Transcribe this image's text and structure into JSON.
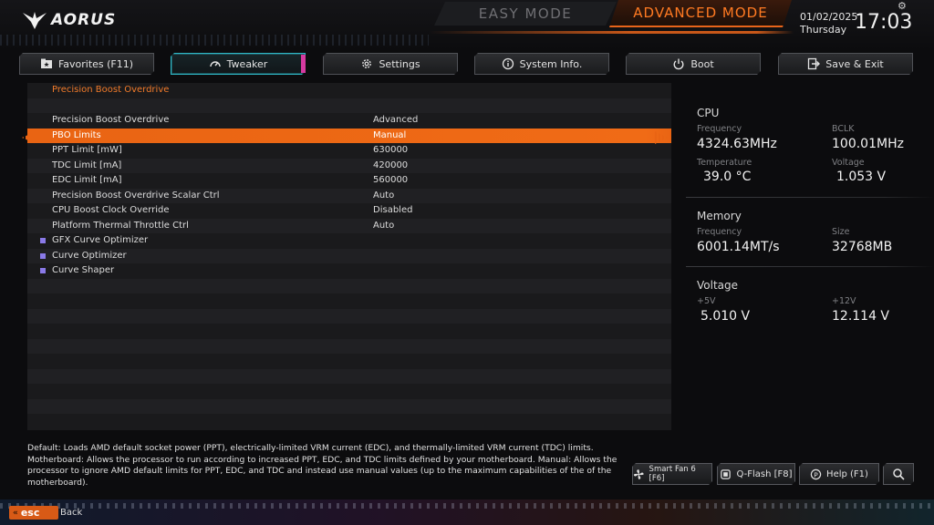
{
  "header": {
    "brand": "AORUS",
    "modes": {
      "easy": "EASY MODE",
      "advanced": "ADVANCED MODE",
      "active": "advanced"
    },
    "date": "01/02/2025",
    "day": "Thursday",
    "time": "17:03",
    "settings_glyph": "⚙"
  },
  "tabs": [
    {
      "label": "Favorites (F11)",
      "icon": "star-folder-icon"
    },
    {
      "label": "Tweaker",
      "icon": "speedometer-icon",
      "active": true
    },
    {
      "label": "Settings",
      "icon": "gear-icon"
    },
    {
      "label": "System Info.",
      "icon": "info-icon"
    },
    {
      "label": "Boot",
      "icon": "power-icon"
    },
    {
      "label": "Save & Exit",
      "icon": "exit-icon"
    }
  ],
  "list": {
    "section": "Precision Boost Overdrive",
    "rows": [
      {
        "label": "Precision Boost Overdrive",
        "value": "Advanced"
      },
      {
        "label": "PBO Limits",
        "value": "Manual",
        "selected": true
      },
      {
        "label": "PPT Limit [mW]",
        "value": "630000"
      },
      {
        "label": "TDC Limit [mA]",
        "value": "420000"
      },
      {
        "label": "EDC Limit [mA]",
        "value": "560000"
      },
      {
        "label": "Precision Boost Overdrive Scalar Ctrl",
        "value": "Auto"
      },
      {
        "label": "CPU Boost Clock Override",
        "value": "Disabled"
      },
      {
        "label": "Platform Thermal Throttle Ctrl",
        "value": "Auto"
      },
      {
        "label": "GFX Curve Optimizer",
        "value": "",
        "submenu": true
      },
      {
        "label": "Curve Optimizer",
        "value": "",
        "submenu": true
      },
      {
        "label": "Curve Shaper",
        "value": "",
        "submenu": true
      }
    ]
  },
  "info": {
    "cpu": {
      "title": "CPU",
      "frequency_label": "Frequency",
      "frequency": "4324.63MHz",
      "bclk_label": "BCLK",
      "bclk": "100.01MHz",
      "temperature_label": "Temperature",
      "temperature": "39.0 °C",
      "voltage_label": "Voltage",
      "voltage": "1.053 V"
    },
    "memory": {
      "title": "Memory",
      "frequency_label": "Frequency",
      "frequency": "6001.14MT/s",
      "size_label": "Size",
      "size": "32768MB"
    },
    "voltage": {
      "title": "Voltage",
      "v5_label": "+5V",
      "v5": "5.010 V",
      "v12_label": "+12V",
      "v12": "12.114 V"
    }
  },
  "help": {
    "line1": "Default: Loads AMD default socket power (PPT), electrically-limited VRM current (EDC), and thermally-limited VRM current (TDC) limits.",
    "line2": "Motherboard: Allows the processor to run according to increased PPT, EDC, and TDC limits defined by your motherboard. Manual: Allows the",
    "line3": "processor to ignore AMD default limits for PPT, EDC, and TDC and instead use manual values (up to the maximum capabilities of the of the",
    "line4": "motherboard)."
  },
  "bottom_buttons": {
    "smartfan": "Smart Fan 6 [F6]",
    "qflash": "Q-Flash [F8]",
    "help": "Help (F1)"
  },
  "footer": {
    "esc": "esc",
    "esc_chevrons": "«",
    "back": "Back"
  },
  "colors": {
    "accent": "#e96413",
    "active_tab": "#2fb7c6",
    "section": "#f07a2a",
    "submenu_bullet": "#8a7ae8"
  }
}
